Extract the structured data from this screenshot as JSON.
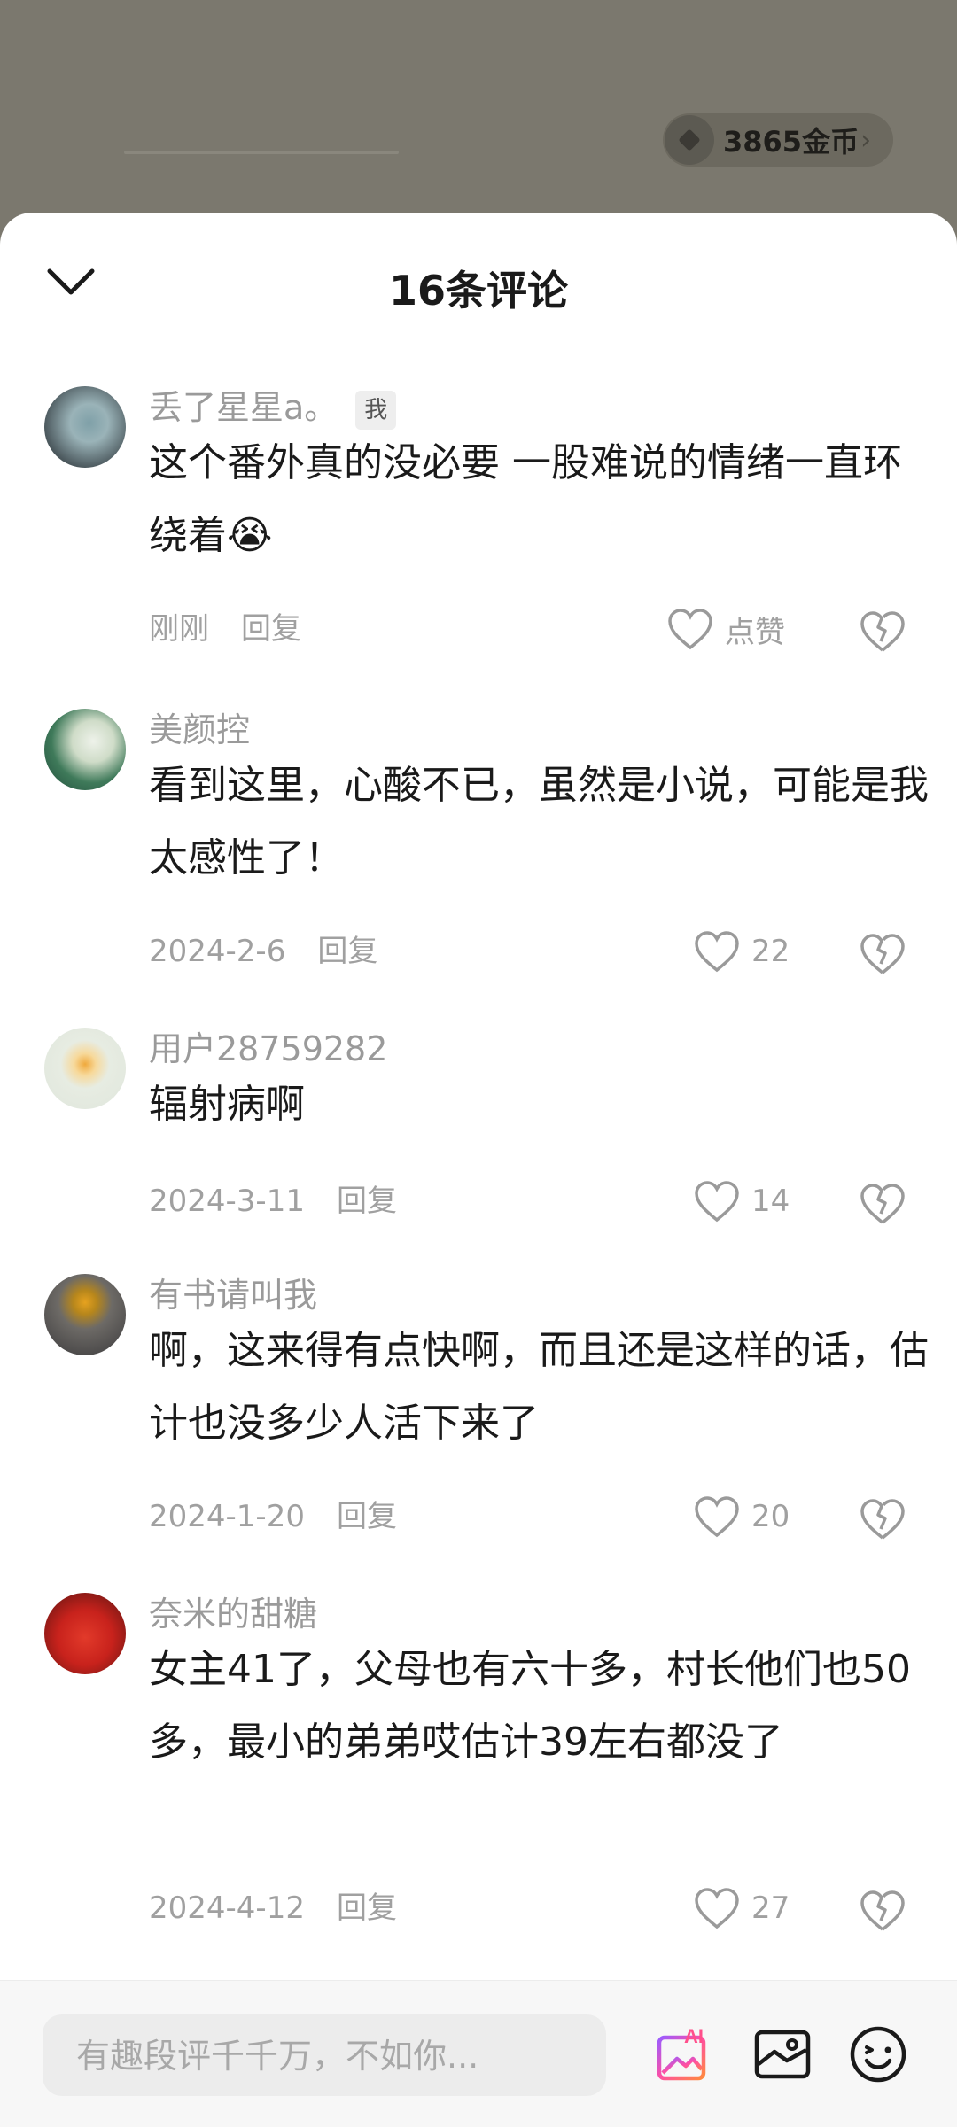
{
  "top": {
    "coins": "3865金币",
    "coins_chevron": "›"
  },
  "sheet": {
    "title": "16条评论"
  },
  "comments": [
    {
      "username": "丢了星星a。",
      "badge": "我",
      "content": "这个番外真的没必要 一股难说的情绪一直环绕着😭",
      "time": "刚刚",
      "reply": "回复",
      "likes": "点赞"
    },
    {
      "username": "美颜控",
      "content": "看到这里，心酸不已，虽然是小说，可能是我太感性了！",
      "time": "2024-2-6",
      "reply": "回复",
      "likes": "22"
    },
    {
      "username": "用户28759282",
      "content": "辐射病啊",
      "time": "2024-3-11",
      "reply": "回复",
      "likes": "14"
    },
    {
      "username": "有书请叫我",
      "content": "啊，这来得有点快啊，而且还是这样的话，估计也没多少人活下来了",
      "time": "2024-1-20",
      "reply": "回复",
      "likes": "20"
    },
    {
      "username": "奈米的甜糖",
      "content": "女主41了，父母也有六十多，村长他们也50多，最小的弟弟哎估计39左右都没了",
      "time": "2024-4-12",
      "reply": "回复",
      "likes": "27"
    }
  ],
  "bottom": {
    "placeholder": "有趣段评千千万，不如你..."
  }
}
